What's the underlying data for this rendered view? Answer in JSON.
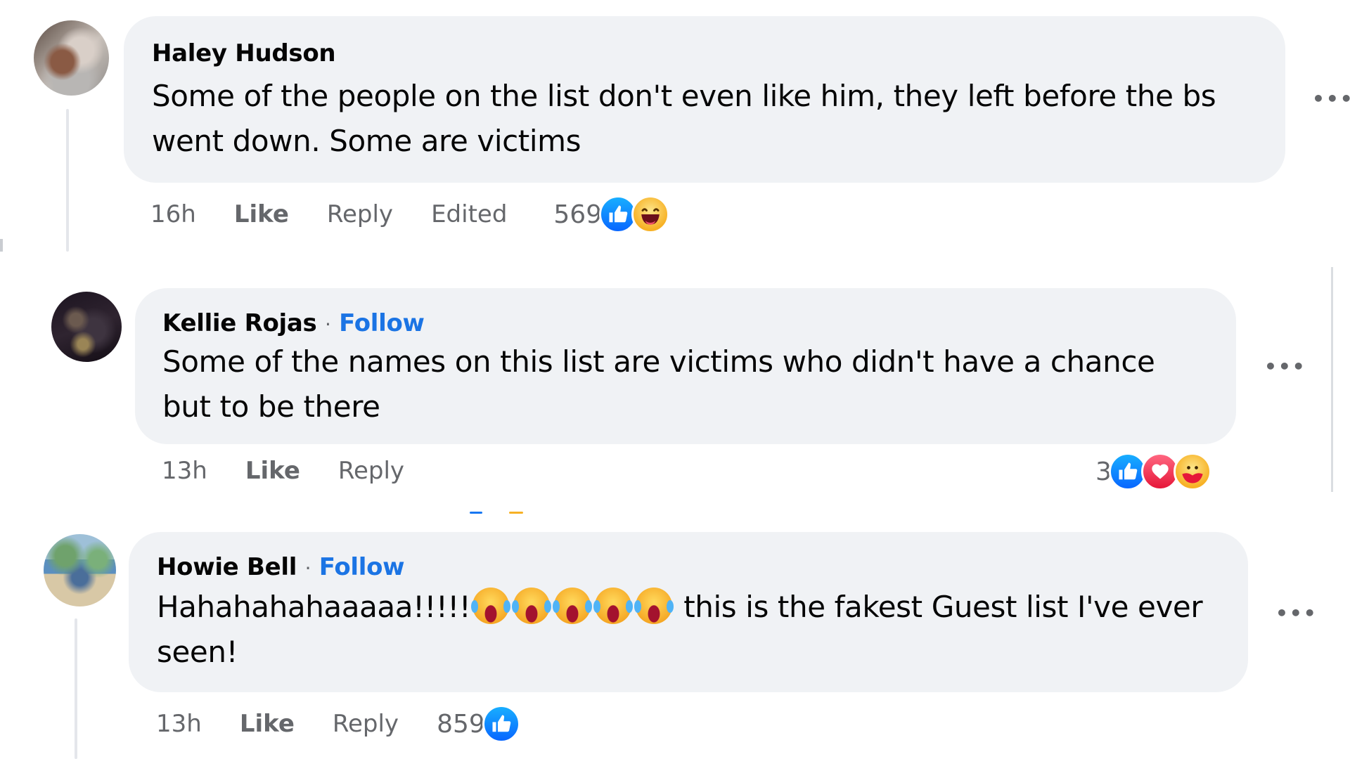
{
  "comments": [
    {
      "author": "Haley Hudson",
      "follow_label": null,
      "text": "Some of the people on the list don't even like him, they left before the bs went down. Some are victims",
      "time": "16h",
      "like_label": "Like",
      "reply_label": "Reply",
      "edited_label": "Edited",
      "reaction_count": "569",
      "reactions": [
        "like-icon",
        "haha-icon"
      ],
      "more_label": "•••"
    },
    {
      "author": "Kellie Rojas",
      "separator": "·",
      "follow_label": "Follow",
      "text": "Some of the names on this list are victims who didn't have a chance but to be there",
      "time": "13h",
      "like_label": "Like",
      "reply_label": "Reply",
      "reaction_count": "3",
      "reactions": [
        "like-icon",
        "love-icon",
        "care-icon"
      ],
      "more_label": "•••"
    },
    {
      "author": "Howie Bell",
      "separator": "·",
      "follow_label": "Follow",
      "text_before_emoji": "Hahahahahaaaaa!!!!!",
      "emoji_count": 5,
      "emoji_name": "tears-of-joy",
      "text_after_emoji": " this is the fakest Guest list I've ever seen!",
      "time": "13h",
      "like_label": "Like",
      "reply_label": "Reply",
      "reaction_count": "859",
      "reactions": [
        "like-icon"
      ],
      "more_label": "•••"
    }
  ],
  "colors": {
    "bubble": "#f0f2f5",
    "link": "#1b74e4",
    "secondary_text": "#65676b",
    "like_blue": "#0866ff",
    "love_red": "#e61739",
    "haha_yellow": "#f7b125"
  }
}
